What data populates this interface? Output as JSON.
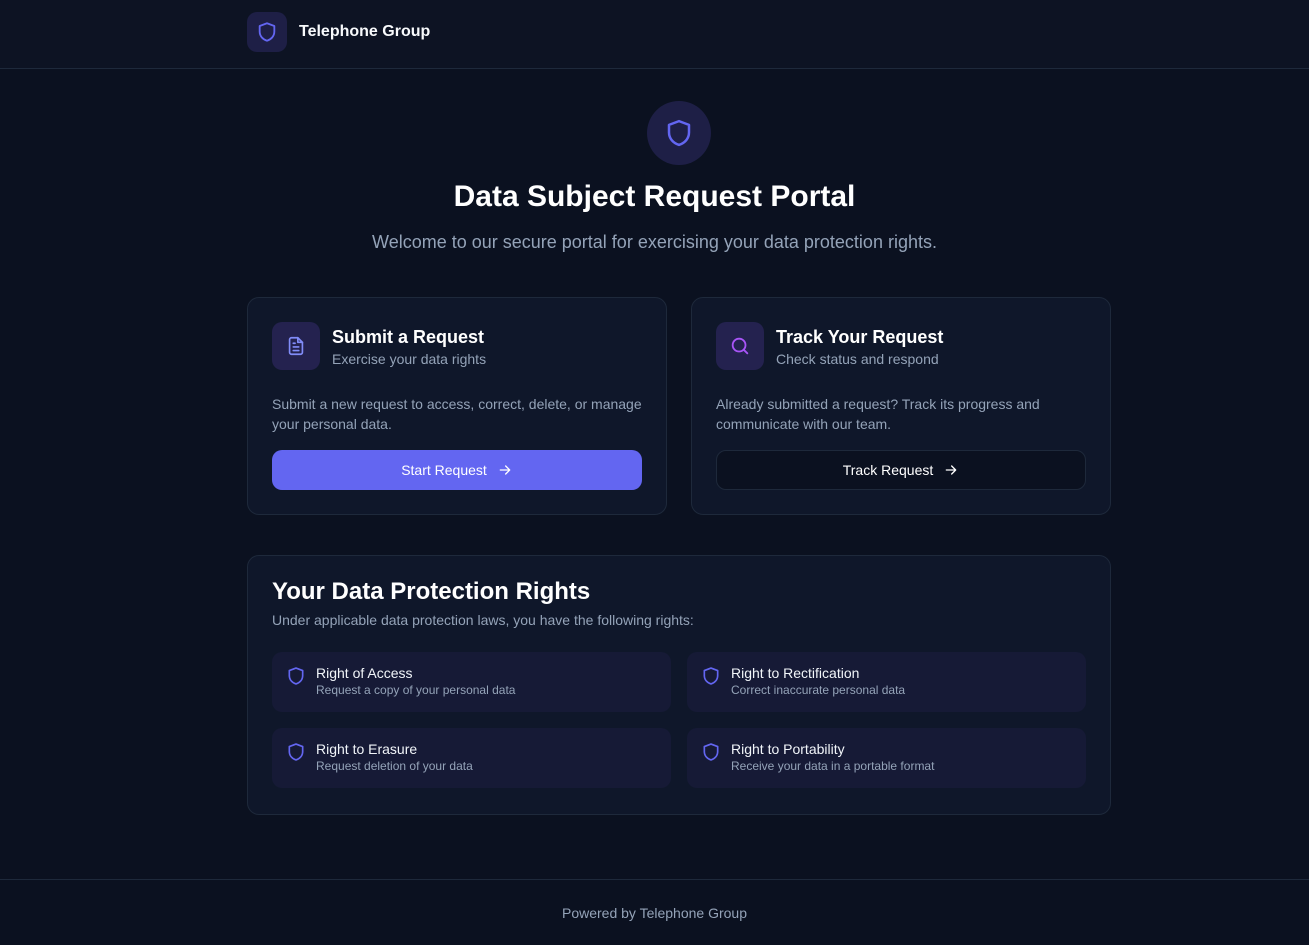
{
  "header": {
    "brand_name": "Telephone Group",
    "brand_icon": "shield-icon"
  },
  "hero": {
    "title": "Data Subject Request Portal",
    "subtitle": "Welcome to our secure portal for exercising your data protection rights.",
    "icon": "shield-icon"
  },
  "cards": {
    "submit": {
      "title": "Submit a Request",
      "subtitle": "Exercise your data rights",
      "description": "Submit a new request to access, correct, delete, or manage your personal data.",
      "button_label": "Start Request",
      "icon": "document-icon"
    },
    "track": {
      "title": "Track Your Request",
      "subtitle": "Check status and respond",
      "description": "Already submitted a request? Track its progress and communicate with our team.",
      "button_label": "Track Request",
      "icon": "search-icon"
    }
  },
  "rights": {
    "title": "Your Data Protection Rights",
    "subtitle": "Under applicable data protection laws, you have the following rights:",
    "items": [
      {
        "title": "Right of Access",
        "description": "Request a copy of your personal data"
      },
      {
        "title": "Right to Rectification",
        "description": "Correct inaccurate personal data"
      },
      {
        "title": "Right to Erasure",
        "description": "Request deletion of your data"
      },
      {
        "title": "Right to Portability",
        "description": "Receive your data in a portable format"
      }
    ]
  },
  "footer": {
    "text": "Powered by Telephone Group"
  },
  "colors": {
    "accent": "#6366f1",
    "background": "#0b1120",
    "card": "#0f172a",
    "border": "#1e293b"
  }
}
